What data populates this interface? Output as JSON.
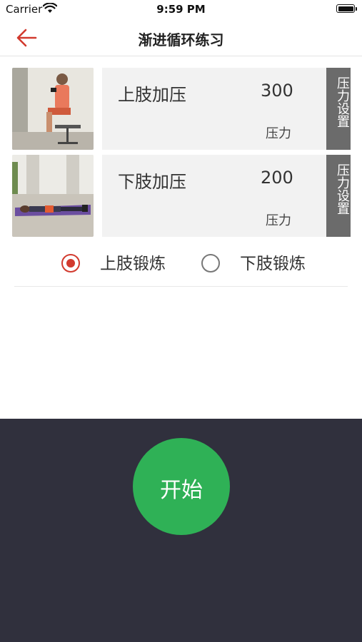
{
  "status_bar": {
    "carrier": "Carrier",
    "time": "9:59 PM"
  },
  "nav": {
    "title": "渐进循环练习",
    "back_icon": "back-arrow-icon",
    "accent_color": "#d23a2e"
  },
  "exercises": [
    {
      "label": "上肢加压",
      "value": "300",
      "unit": "压力",
      "button": "压力设置",
      "photo": "seated-arm-cuff-photo"
    },
    {
      "label": "下肢加压",
      "value": "200",
      "unit": "压力",
      "button": "压力设置",
      "photo": "lying-leg-cuff-photo"
    }
  ],
  "mode_options": [
    {
      "label": "上肢锻炼",
      "selected": true
    },
    {
      "label": "下肢锻炼",
      "selected": false
    }
  ],
  "start_button": {
    "label": "开始",
    "color": "#2fb156"
  },
  "colors": {
    "panel_bg": "#30303d",
    "setting_button_bg": "#6b6b6b"
  }
}
